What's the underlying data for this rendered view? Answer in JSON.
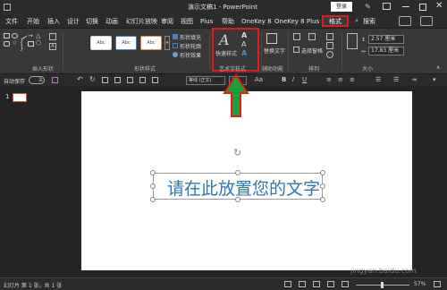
{
  "titlebar": {
    "title": "演示文稿1 - PowerPoint",
    "login_label": "登录"
  },
  "menu_tabs": [
    "文件",
    "开始",
    "插入",
    "设计",
    "切换",
    "动画",
    "幻灯片放映",
    "审阅",
    "视图",
    "Plus",
    "帮助",
    "OneKey 8",
    "OneKey 8 Plus",
    "格式",
    "搜索"
  ],
  "ribbon": {
    "groups": [
      "插入形状",
      "形状样式",
      "艺术字样式",
      "辅助功能",
      "排列",
      "大小"
    ],
    "shape_style_options": [
      "形状填充",
      "形状轮廓",
      "形状效果"
    ],
    "style_box_label": "Abc",
    "quick_styles_label": "快速样式",
    "alt_text_label": "替换文字",
    "selection_pane_label": "选择窗格",
    "height_value": "2.57 厘米",
    "width_value": "17.83 厘米"
  },
  "qat": {
    "autosave_label": "自动保存",
    "autosave_state": "关",
    "font_name": "等线 (正文)",
    "font_size": "28"
  },
  "slide": {
    "thumbnail_number": "1",
    "text": "请在此放置您的文字"
  },
  "status": {
    "slide_info": "幻灯片 第 1 张，共 1 张",
    "zoom": "57%",
    "watermark": "jingyan.baidu.com"
  },
  "colors": {
    "accent_red": "#e11c1c",
    "arrow_green": "#1e9e3a",
    "text_blue": "#2e75b6"
  }
}
